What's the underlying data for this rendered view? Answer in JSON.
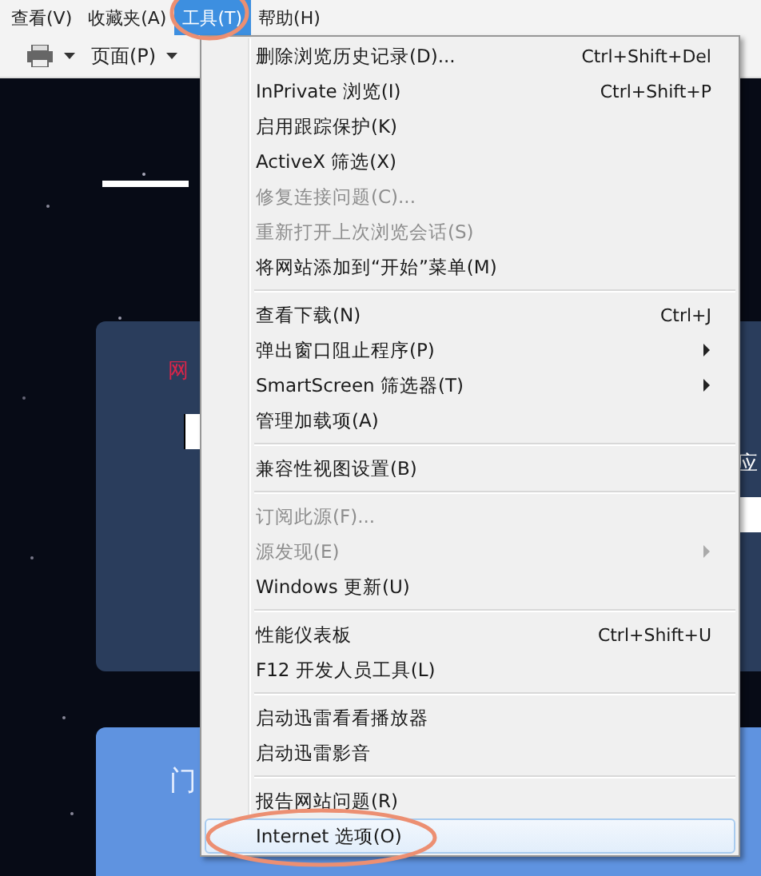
{
  "menu_bar": [
    {
      "label": "查看(V)",
      "selected": false
    },
    {
      "label": "收藏夹(A)",
      "selected": false
    },
    {
      "label": "工具(T)",
      "selected": true
    },
    {
      "label": "帮助(H)",
      "selected": false
    }
  ],
  "toolbar": [
    {
      "kind": "print"
    },
    {
      "kind": "text",
      "label": "页面(P)"
    }
  ],
  "page": {
    "red_text": "网",
    "side_text": "应",
    "button_text": "门"
  },
  "tools_menu": [
    [
      {
        "label": "删除浏览历史记录(D)...",
        "shortcut": "Ctrl+Shift+Del",
        "disabled": false,
        "submenu": false,
        "selected": false
      },
      {
        "label": "InPrivate 浏览(I)",
        "shortcut": "Ctrl+Shift+P",
        "disabled": false,
        "submenu": false,
        "selected": false
      },
      {
        "label": "启用跟踪保护(K)",
        "disabled": false,
        "submenu": false,
        "selected": false
      },
      {
        "label": "ActiveX 筛选(X)",
        "disabled": false,
        "submenu": false,
        "selected": false
      },
      {
        "label": "修复连接问题(C)...",
        "disabled": true,
        "submenu": false,
        "selected": false
      },
      {
        "label": "重新打开上次浏览会话(S)",
        "disabled": true,
        "submenu": false,
        "selected": false
      },
      {
        "label": "将网站添加到“开始”菜单(M)",
        "disabled": false,
        "submenu": false,
        "selected": false
      }
    ],
    [
      {
        "label": "查看下载(N)",
        "shortcut": "Ctrl+J",
        "disabled": false,
        "submenu": false,
        "selected": false
      },
      {
        "label": "弹出窗口阻止程序(P)",
        "disabled": false,
        "submenu": true,
        "selected": false
      },
      {
        "label": "SmartScreen 筛选器(T)",
        "disabled": false,
        "submenu": true,
        "selected": false
      },
      {
        "label": "管理加载项(A)",
        "disabled": false,
        "submenu": false,
        "selected": false
      }
    ],
    [
      {
        "label": "兼容性视图设置(B)",
        "disabled": false,
        "submenu": false,
        "selected": false
      }
    ],
    [
      {
        "label": "订阅此源(F)...",
        "disabled": true,
        "submenu": false,
        "selected": false
      },
      {
        "label": "源发现(E)",
        "disabled": true,
        "submenu": true,
        "selected": false
      },
      {
        "label": "Windows 更新(U)",
        "disabled": false,
        "submenu": false,
        "selected": false
      }
    ],
    [
      {
        "label": "性能仪表板",
        "shortcut": "Ctrl+Shift+U",
        "disabled": false,
        "submenu": false,
        "selected": false
      },
      {
        "label": "F12 开发人员工具(L)",
        "disabled": false,
        "submenu": false,
        "selected": false
      }
    ],
    [
      {
        "label": "启动迅雷看看播放器",
        "disabled": false,
        "submenu": false,
        "selected": false
      },
      {
        "label": "启动迅雷影音",
        "disabled": false,
        "submenu": false,
        "selected": false
      }
    ],
    [
      {
        "label": "报告网站问题(R)",
        "disabled": false,
        "submenu": false,
        "selected": false
      },
      {
        "label": "Internet 选项(O)",
        "disabled": false,
        "submenu": false,
        "selected": true
      }
    ]
  ]
}
